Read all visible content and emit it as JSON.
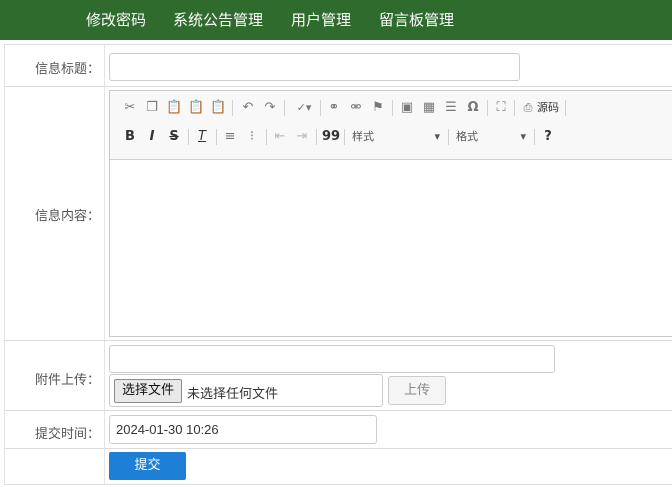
{
  "nav": {
    "items": [
      "修改密码",
      "系统公告管理",
      "用户管理",
      "留言板管理"
    ]
  },
  "form": {
    "title_label": "信息标题：",
    "title_value": "",
    "content_label": "信息内容：",
    "attachment_label": "附件上传：",
    "attachment_path": "",
    "choose_file_label": "选择文件",
    "no_file_text": "未选择任何文件",
    "upload_label": "上传",
    "time_label": "提交时间：",
    "time_value": "2024-01-30 10:26",
    "submit_label": "提交"
  },
  "editor": {
    "source_label": "源码",
    "styles_label": "样式",
    "format_label": "格式",
    "bold": "B",
    "italic": "I",
    "strike": "S",
    "help": "?",
    "quote": "99",
    "omega": "Ω"
  },
  "colors": {
    "nav_bg": "#2f6b2c",
    "submit_bg": "#1e7fd6"
  }
}
